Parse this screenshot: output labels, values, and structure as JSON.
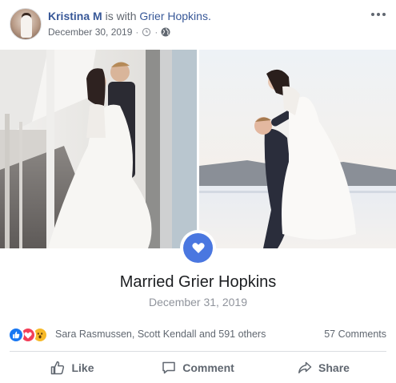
{
  "post": {
    "author_name": "Kristina M",
    "with_text": "is with",
    "tagged_name": "Grier Hopkins.",
    "date": "December 30, 2019",
    "privacy": "public",
    "icons": {
      "avatar": "profile-photo",
      "clock": "clock-icon",
      "privacy": "globe-icon",
      "more": "more-options-icon"
    }
  },
  "event": {
    "icon": "heart-icon",
    "icon_color": "#4a77e0",
    "title": "Married Grier Hopkins",
    "date": "December 31, 2019"
  },
  "reactions": {
    "types": [
      "like",
      "love",
      "wow"
    ],
    "colors": {
      "like": "#1877f2",
      "love": "#f33e58",
      "wow": "#f7b928"
    },
    "summary": "Sara Rasmussen, Scott Kendall and 591 others",
    "comments": "57 Comments"
  },
  "actions": {
    "like": "Like",
    "comment": "Comment",
    "share": "Share"
  },
  "colors": {
    "link": "#385898",
    "secondary_text": "#616770"
  }
}
